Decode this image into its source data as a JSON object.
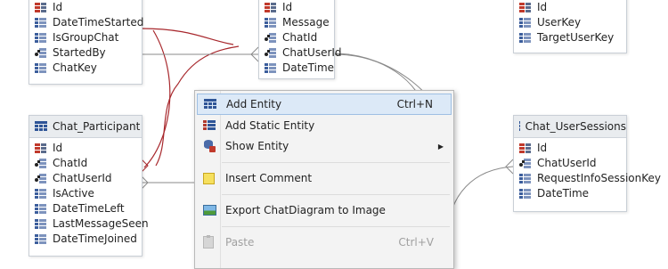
{
  "entities": {
    "chat": {
      "fields": [
        "Id",
        "DateTimeStarted",
        "IsGroupChat",
        "StartedBy",
        "ChatKey"
      ]
    },
    "message": {
      "fields": [
        "Id",
        "Message",
        "ChatId",
        "ChatUserId",
        "DateTime"
      ]
    },
    "user_target": {
      "fields": [
        "Id",
        "UserKey",
        "TargetUserKey"
      ]
    },
    "chat_participant": {
      "title": "Chat_Participant",
      "fields": [
        "Id",
        "ChatId",
        "ChatUserId",
        "IsActive",
        "DateTimeLeft",
        "LastMessageSeen",
        "DateTimeJoined"
      ]
    },
    "chat_user_sessions": {
      "title": "Chat_UserSessions",
      "fields": [
        "Id",
        "ChatUserId",
        "RequestInfoSessionKey",
        "DateTime"
      ]
    }
  },
  "context_menu": {
    "items": [
      {
        "label": "Add Entity",
        "shortcut": "Ctrl+N",
        "icon": "table-icon"
      },
      {
        "label": "Add Static Entity",
        "shortcut": "",
        "icon": "static-entity-icon"
      },
      {
        "label": "Show Entity",
        "shortcut": "",
        "icon": "show-entity-icon",
        "submenu_arrow": "▶"
      },
      {
        "label": "Insert Comment",
        "shortcut": "",
        "icon": "note-icon"
      },
      {
        "label": "Export ChatDiagram to Image",
        "shortcut": "",
        "icon": "image-icon"
      },
      {
        "label": "Paste",
        "shortcut": "Ctrl+V",
        "icon": "paste-icon"
      }
    ]
  },
  "colors": {
    "relation_red": "#a8282d",
    "relation_gray": "#8a8a8a",
    "menu_highlight": "#dce9f7"
  }
}
